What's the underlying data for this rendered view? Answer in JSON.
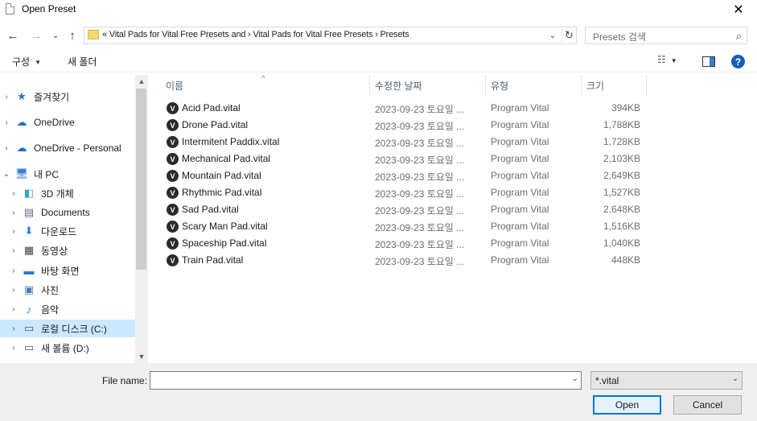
{
  "window": {
    "title": "Open Preset",
    "close_glyph": "✕"
  },
  "address": {
    "path": "«  Vital Pads for Vital Free Presets and ›  Vital Pads for Vital Free Presets  ›  Presets",
    "search_placeholder": "Presets 검색"
  },
  "toolbar": {
    "organize_label": "구성",
    "new_folder_label": "새 폴더"
  },
  "nav": {
    "items": [
      {
        "label": "즐겨찾기",
        "icon": "star-icon",
        "glyph": "★",
        "color": "#2a72c8",
        "level": 0,
        "expander": "›"
      },
      {
        "label": "OneDrive",
        "icon": "cloud-icon",
        "glyph": "☁",
        "color": "#1e6fd0",
        "level": 0,
        "expander": "›"
      },
      {
        "label": "OneDrive - Personal",
        "icon": "cloud-icon",
        "glyph": "☁",
        "color": "#1e6fd0",
        "level": 0,
        "expander": "›"
      },
      {
        "label": "내 PC",
        "icon": "pc-icon",
        "glyph": "🖥",
        "color": "#3a7bd5",
        "level": 0,
        "expander": "⌄"
      },
      {
        "label": "3D 개체",
        "icon": "cube-icon",
        "glyph": "◧",
        "color": "#3aa0d8",
        "level": 1,
        "expander": "›"
      },
      {
        "label": "Documents",
        "icon": "document-icon",
        "glyph": "▤",
        "color": "#5a6b80",
        "level": 1,
        "expander": "›"
      },
      {
        "label": "다운로드",
        "icon": "download-icon",
        "glyph": "⬇",
        "color": "#2d7fd6",
        "level": 1,
        "expander": "›"
      },
      {
        "label": "동영상",
        "icon": "video-icon",
        "glyph": "▦",
        "color": "#444444",
        "level": 1,
        "expander": "›"
      },
      {
        "label": "바탕 화면",
        "icon": "desktop-icon",
        "glyph": "▬",
        "color": "#1f7ad4",
        "level": 1,
        "expander": "›"
      },
      {
        "label": "사진",
        "icon": "pictures-icon",
        "glyph": "▣",
        "color": "#4b7bb5",
        "level": 1,
        "expander": "›"
      },
      {
        "label": "음악",
        "icon": "music-icon",
        "glyph": "♪",
        "color": "#2a6fc9",
        "level": 1,
        "expander": "›"
      },
      {
        "label": "로컬 디스크 (C:)",
        "icon": "drive-icon",
        "glyph": "▭",
        "color": "#555555",
        "level": 1,
        "expander": "›",
        "selected": true
      },
      {
        "label": "새 볼륨 (D:)",
        "icon": "drive-icon",
        "glyph": "▭",
        "color": "#555555",
        "level": 1,
        "expander": "›"
      }
    ]
  },
  "columns": {
    "name": "이름",
    "date": "수정한 날짜",
    "type": "유형",
    "size": "크기"
  },
  "files": [
    {
      "name": "Acid Pad.vital",
      "date": "2023-09-23 토요일 ...",
      "type": "Program Vital",
      "size": "394KB"
    },
    {
      "name": "Drone Pad.vital",
      "date": "2023-09-23 토요일 ...",
      "type": "Program Vital",
      "size": "1,788KB"
    },
    {
      "name": "Intermitent Paddix.vital",
      "date": "2023-09-23 토요일 ...",
      "type": "Program Vital",
      "size": "1,728KB"
    },
    {
      "name": "Mechanical Pad.vital",
      "date": "2023-09-23 토요일 ...",
      "type": "Program Vital",
      "size": "2,103KB"
    },
    {
      "name": "Mountain Pad.vital",
      "date": "2023-09-23 토요일 ...",
      "type": "Program Vital",
      "size": "2,649KB"
    },
    {
      "name": "Rhythmic Pad.vital",
      "date": "2023-09-23 토요일 ...",
      "type": "Program Vital",
      "size": "1,527KB"
    },
    {
      "name": "Sad Pad.vital",
      "date": "2023-09-23 토요일 ...",
      "type": "Program Vital",
      "size": "2,648KB"
    },
    {
      "name": "Scary Man Pad.vital",
      "date": "2023-09-23 토요일 ...",
      "type": "Program Vital",
      "size": "1,516KB"
    },
    {
      "name": "Spaceship Pad.vital",
      "date": "2023-09-23 토요일 ...",
      "type": "Program Vital",
      "size": "1,040KB"
    },
    {
      "name": "Train Pad.vital",
      "date": "2023-09-23 토요일 ...",
      "type": "Program Vital",
      "size": "448KB"
    }
  ],
  "bottom": {
    "file_name_label": "File name:",
    "file_name_value": "",
    "filter_value": "*.vital",
    "open_label": "Open",
    "cancel_label": "Cancel"
  },
  "colors": {
    "accent": "#0078d7",
    "selection": "#cce8ff",
    "header_text": "#4c607a"
  }
}
